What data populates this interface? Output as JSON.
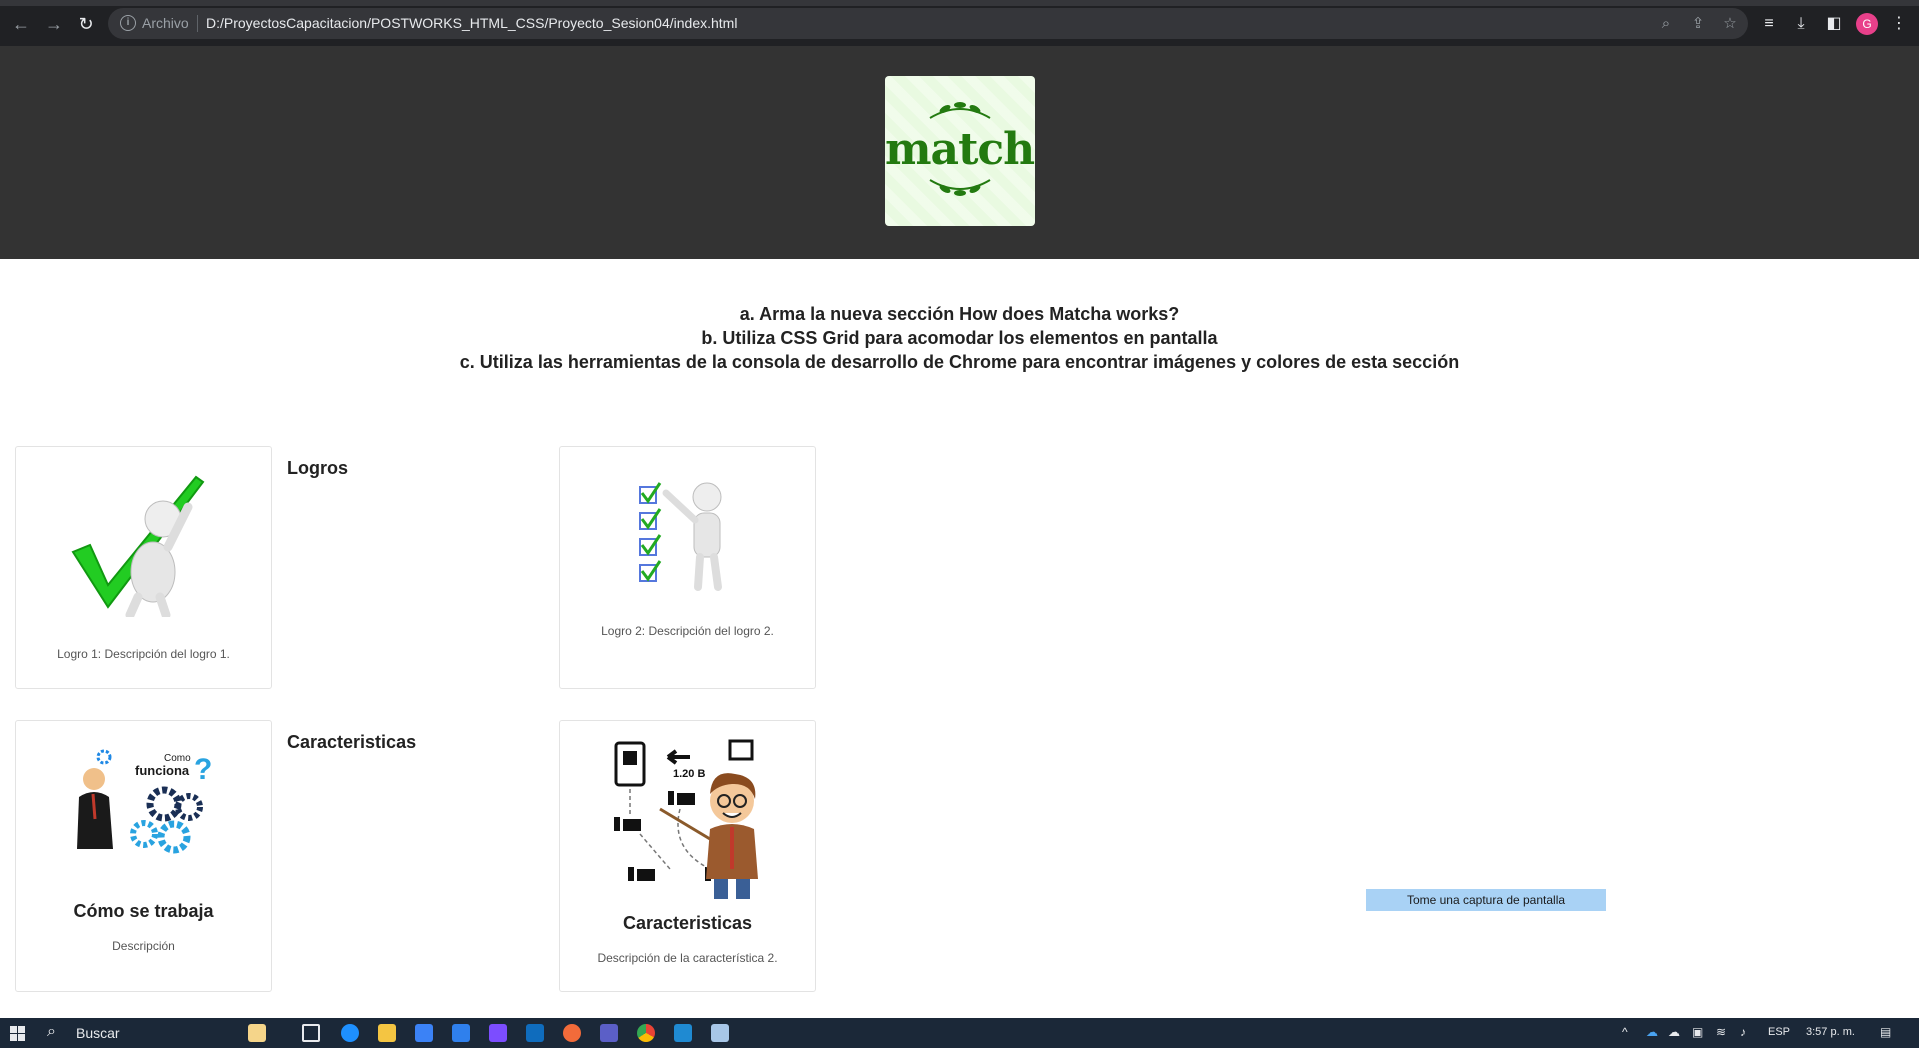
{
  "browser": {
    "scheme_label": "Archivo",
    "url": "D:/ProyectosCapacitacion/POSTWORKS_HTML_CSS/Proyecto_Sesion04/index.html",
    "avatar_initial": "G",
    "colors": {
      "chrome": "#202124",
      "omnibox": "#35363a",
      "avatar": "#e8408a"
    }
  },
  "header": {
    "logo_text": "matcha",
    "background": "#333333",
    "logo_background": "#e9fae1",
    "logo_color": "#237a10"
  },
  "instructions": {
    "line_a": "a. Arma la nueva sección How does Matcha works?",
    "line_b": "b. Utiliza CSS Grid para acomodar los elementos en pantalla",
    "line_c": "c. Utiliza las herramientas de la consola de desarrollo de Chrome para encontrar imágenes y colores de esta sección"
  },
  "sections": {
    "logros": {
      "title": "Logros",
      "card1_caption": "Logro 1: Descripción del logro 1.",
      "card2_caption": "Logro 2: Descripción del logro 2."
    },
    "caracteristicas": {
      "title": "Caracteristicas",
      "card1_title": "Cómo se trabaja",
      "card1_caption": "Descripción",
      "card1_image_text_como": "Como",
      "card1_image_text_funciona": "funciona",
      "card2_title": "Caracteristicas",
      "card2_caption": "Descripción de la característica 2.",
      "card2_image_label": "1.20 B"
    }
  },
  "overlay": {
    "capture_button": "Tome una captura de pantalla"
  },
  "taskbar": {
    "search_placeholder": "Buscar",
    "language": "ESP",
    "time": "3:57 p. m."
  }
}
